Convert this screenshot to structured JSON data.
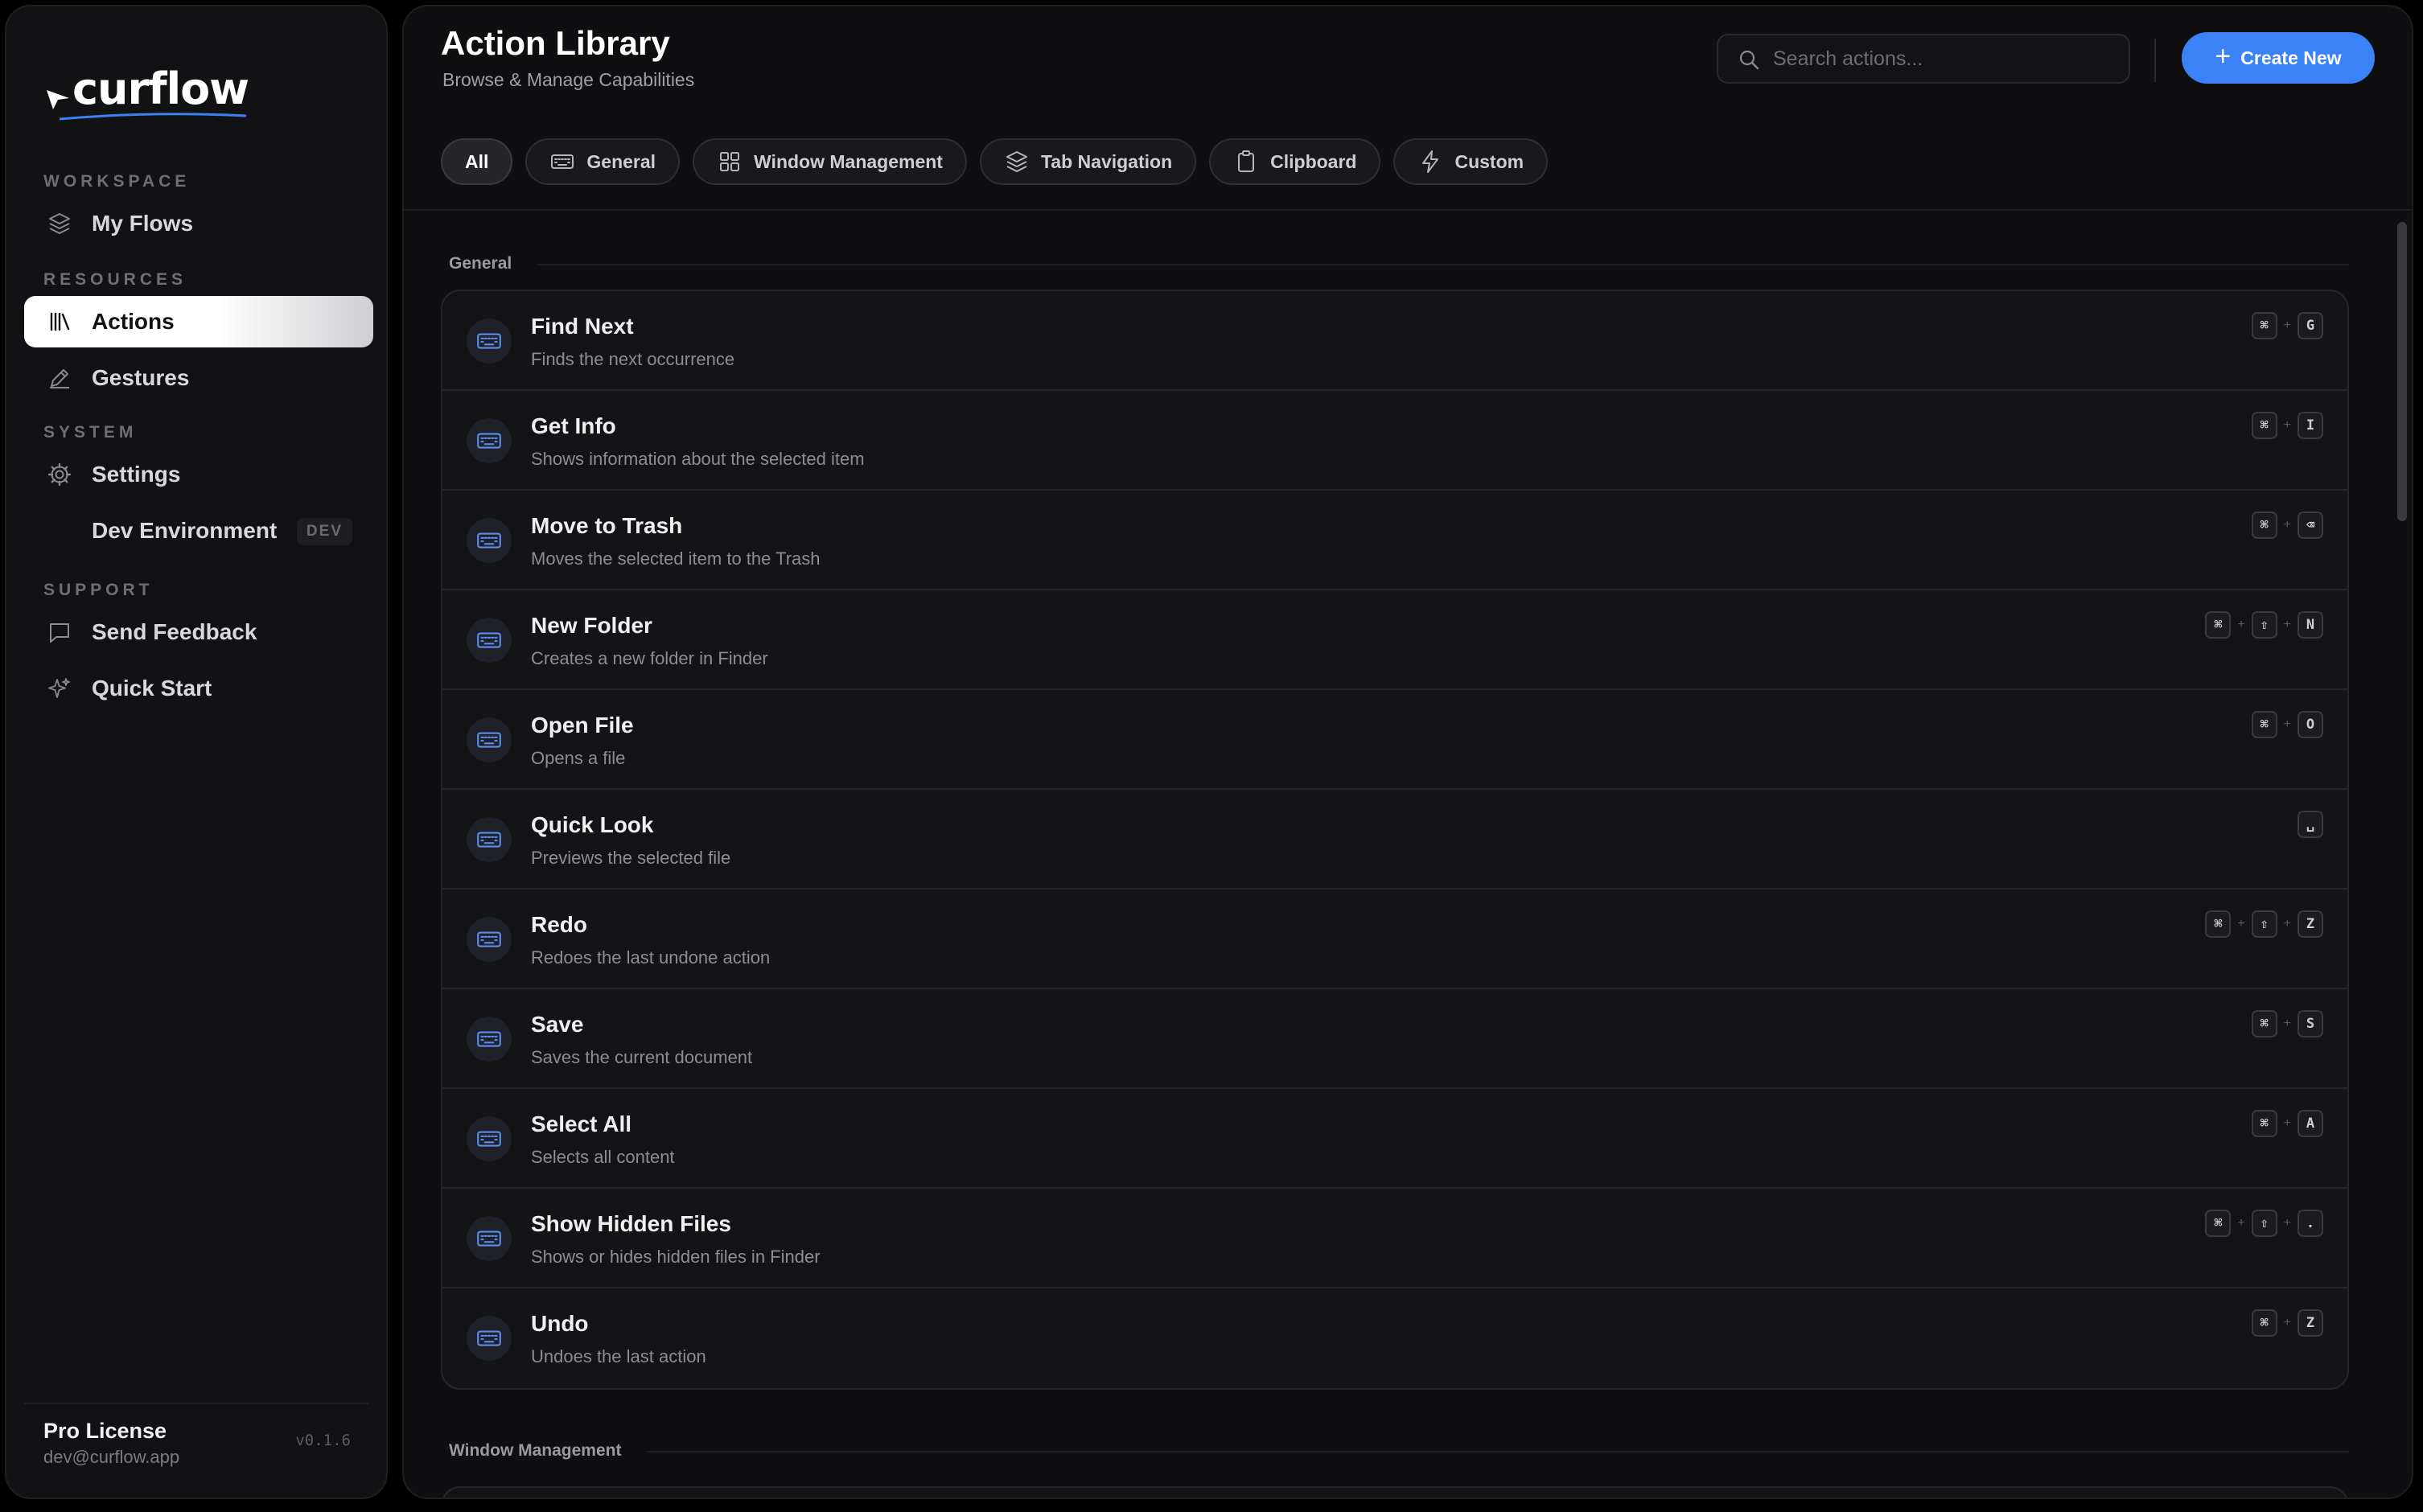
{
  "brand": {
    "name": "curflow"
  },
  "sidebar": {
    "sections": {
      "workspace": "WORKSPACE",
      "resources": "RESOURCES",
      "system": "SYSTEM",
      "support": "SUPPORT"
    },
    "items": {
      "my_flows": "My Flows",
      "actions": "Actions",
      "gestures": "Gestures",
      "settings": "Settings",
      "dev_environment": "Dev Environment",
      "dev_badge": "DEV",
      "send_feedback": "Send Feedback",
      "quick_start": "Quick Start"
    },
    "footer": {
      "license": "Pro License",
      "email": "dev@curflow.app",
      "version": "v0.1.6"
    }
  },
  "header": {
    "title": "Action Library",
    "subtitle": "Browse & Manage Capabilities",
    "search_placeholder": "Search actions...",
    "create_label": "Create New"
  },
  "tabs": [
    "All",
    "General",
    "Window Management",
    "Tab Navigation",
    "Clipboard",
    "Custom"
  ],
  "groups": {
    "general": "General",
    "window_management": "Window Management"
  },
  "actions": [
    {
      "title": "Find Next",
      "desc": "Finds the next occurrence",
      "keys": [
        "⌘",
        "G"
      ]
    },
    {
      "title": "Get Info",
      "desc": "Shows information about the selected item",
      "keys": [
        "⌘",
        "I"
      ]
    },
    {
      "title": "Move to Trash",
      "desc": "Moves the selected item to the Trash",
      "keys": [
        "⌘",
        "⌫"
      ]
    },
    {
      "title": "New Folder",
      "desc": "Creates a new folder in Finder",
      "keys": [
        "⌘",
        "⇧",
        "N"
      ]
    },
    {
      "title": "Open File",
      "desc": "Opens a file",
      "keys": [
        "⌘",
        "O"
      ]
    },
    {
      "title": "Quick Look",
      "desc": "Previews the selected file",
      "keys": [
        "␣"
      ]
    },
    {
      "title": "Redo",
      "desc": "Redoes the last undone action",
      "keys": [
        "⌘",
        "⇧",
        "Z"
      ]
    },
    {
      "title": "Save",
      "desc": "Saves the current document",
      "keys": [
        "⌘",
        "S"
      ]
    },
    {
      "title": "Select All",
      "desc": "Selects all content",
      "keys": [
        "⌘",
        "A"
      ]
    },
    {
      "title": "Show Hidden Files",
      "desc": "Shows or hides hidden files in Finder",
      "keys": [
        "⌘",
        "⇧",
        "."
      ]
    },
    {
      "title": "Undo",
      "desc": "Undoes the last action",
      "keys": [
        "⌘",
        "Z"
      ]
    }
  ],
  "colors": {
    "accent": "#3b82f6",
    "background": "#000000",
    "panel": "#121214",
    "row_icon": "#5b8def"
  }
}
